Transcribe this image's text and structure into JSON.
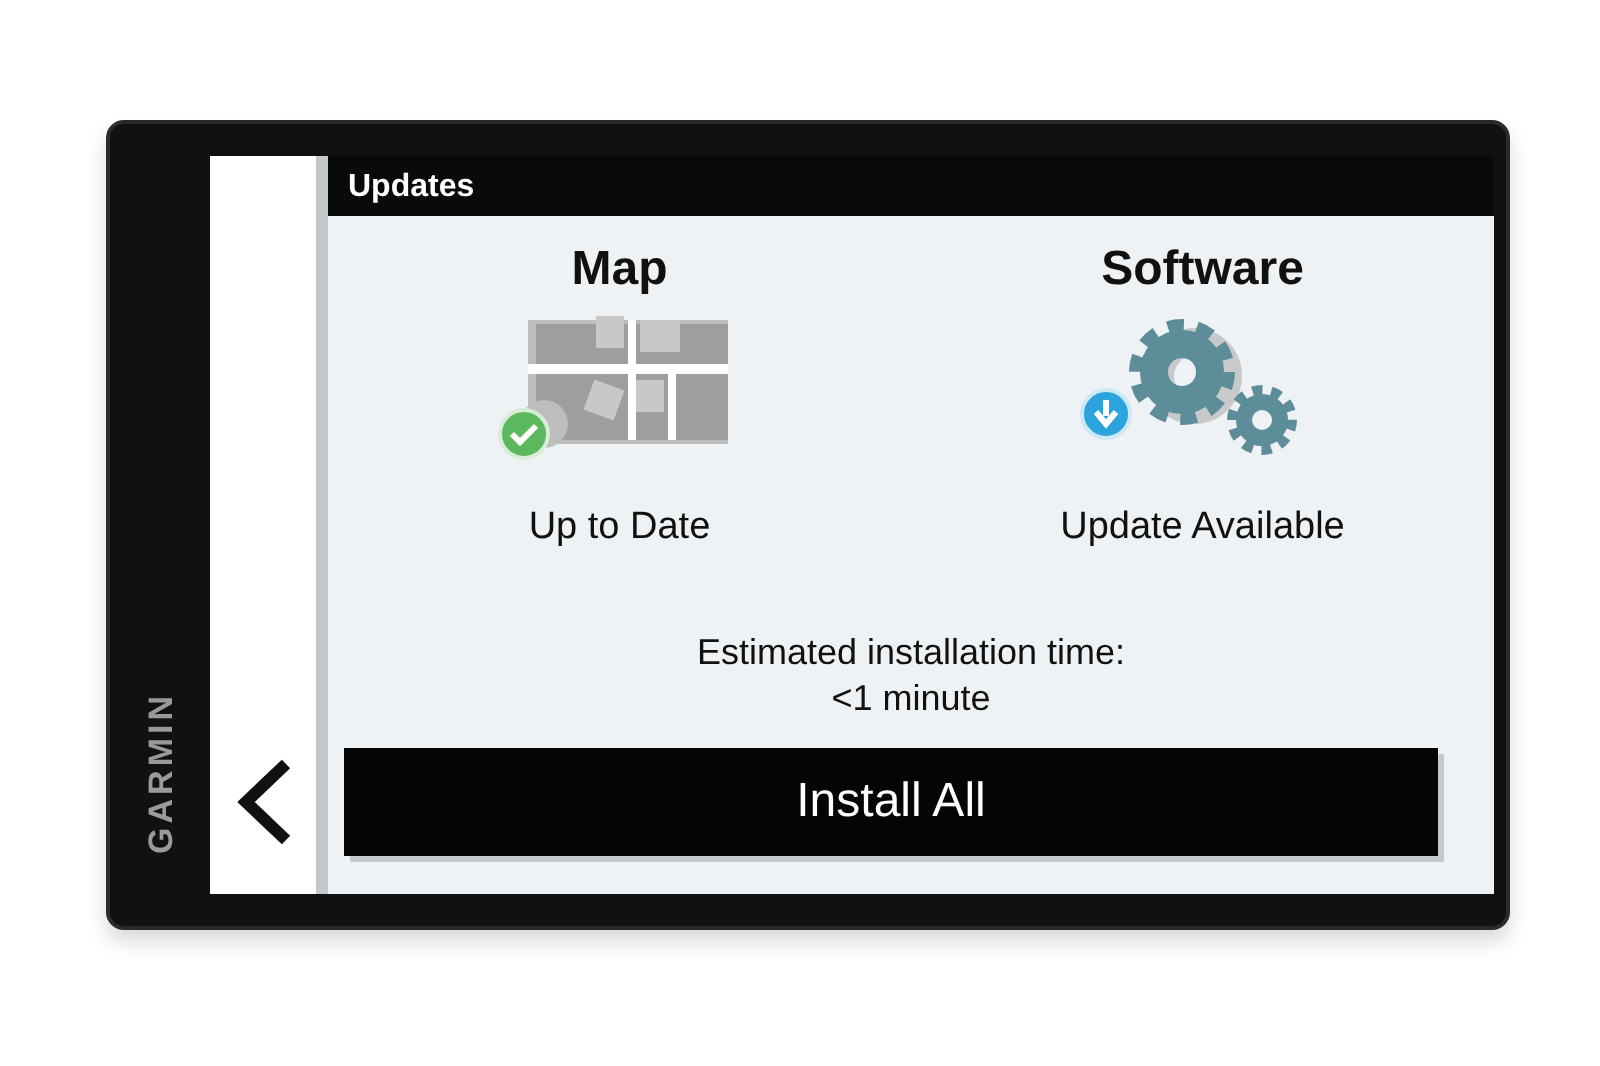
{
  "device": {
    "brand": "GARMIN"
  },
  "screen": {
    "title": "Updates",
    "items": [
      {
        "kind": "map",
        "title": "Map",
        "badge": {
          "kind": "check"
        },
        "status_text": "Up to Date"
      },
      {
        "kind": "software",
        "title": "Software",
        "badge": {
          "kind": "download"
        },
        "status_text": "Update Available"
      }
    ],
    "estimate": [
      "Estimated installation time:",
      "<1 minute"
    ],
    "button": "Install All"
  }
}
